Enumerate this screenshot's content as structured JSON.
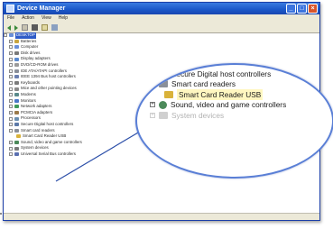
{
  "window": {
    "title": "Device Manager",
    "controls": [
      "_",
      "□",
      "×"
    ]
  },
  "menu": [
    "File",
    "Action",
    "View",
    "Help"
  ],
  "toolbar_icons": [
    "back-icon",
    "forward-icon",
    "properties-icon",
    "print-icon",
    "help-icon",
    "scan-icon"
  ],
  "tree": {
    "root": "DESKTOP",
    "items": [
      "Batteries",
      "Computer",
      "Disk drives",
      "Display adapters",
      "DVD/CD-ROM drives",
      "IDE ATA/ATAPI controllers",
      "IEEE 1394 Bus host controllers",
      "Keyboards",
      "Mice and other pointing devices",
      "Modems",
      "Monitors",
      "Network adapters",
      "PCMCIA adapters",
      "Processors",
      "Secure Digital host controllers",
      "Smart card readers",
      "Smart Card Reader USB",
      "Sound, video and game controllers",
      "System devices",
      "Universal Serial Bus controllers"
    ]
  },
  "zoom": {
    "rows": [
      "Secure Digital host controllers",
      "Smart card readers",
      "Smart Card Reader USB",
      "Sound, video and game controllers",
      "System devices"
    ]
  },
  "colors": {
    "titlebar": "#1b57c8",
    "callout_ring": "#5a7fd6",
    "selection": "#2f5cc7"
  }
}
